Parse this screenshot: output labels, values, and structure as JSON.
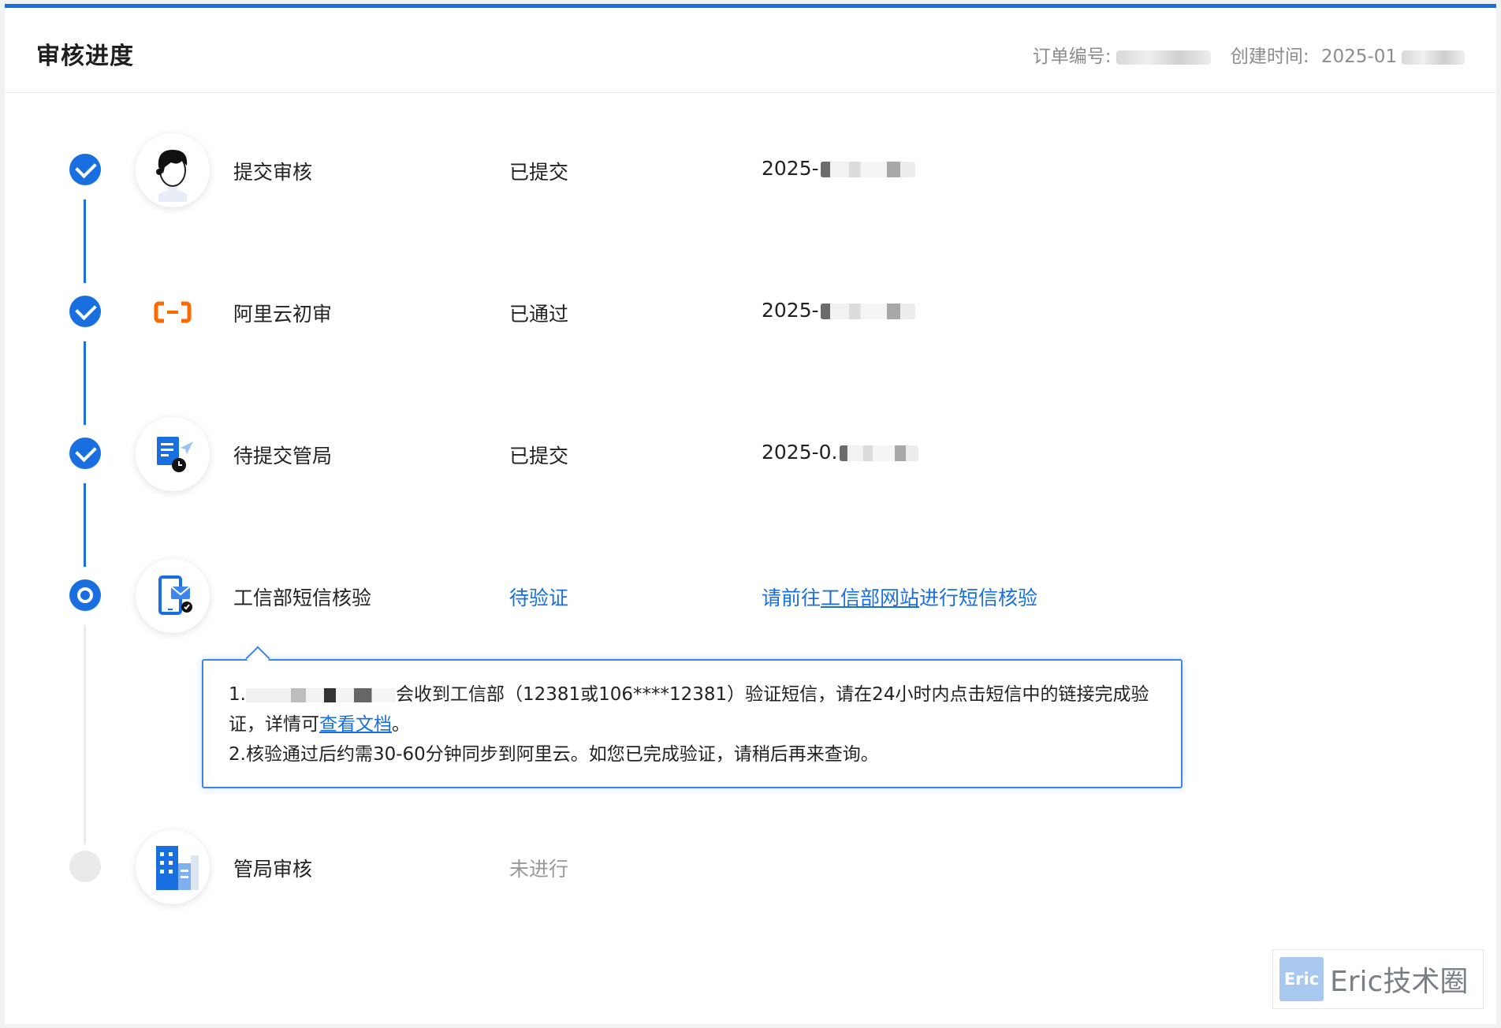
{
  "header": {
    "title": "审核进度",
    "order_label": "订单编号:",
    "created_label": "创建时间:",
    "created_value": "2025-01"
  },
  "steps": [
    {
      "name": "提交审核",
      "status": "已提交",
      "time": "2025-",
      "icon": "user-avatar-icon",
      "state": "done"
    },
    {
      "name": "阿里云初审",
      "status": "已通过",
      "time": "2025-",
      "icon": "aliyun-logo-icon",
      "state": "done"
    },
    {
      "name": "待提交管局",
      "status": "已提交",
      "time": "2025-0.",
      "icon": "document-send-icon",
      "state": "done"
    },
    {
      "name": "工信部短信核验",
      "status": "待验证",
      "action_prefix": "请前往",
      "action_link": "工信部网站",
      "action_suffix": "进行短信核验",
      "icon": "phone-message-icon",
      "state": "current"
    },
    {
      "name": "管局审核",
      "status": "未进行",
      "icon": "building-icon",
      "state": "pending"
    }
  ],
  "tooltip": {
    "line1_prefix": "1.",
    "line1_text": "会收到工信部（12381或106****12381）验证短信，请在24小时内点击短信中的链接完成验",
    "line1b_text": "证，详情可",
    "doc_link": "查看文档",
    "line1b_end": "。",
    "line2_text": "2.核验通过后约需30-60分钟同步到阿里云。如您已完成验证，请稍后再来查询。"
  },
  "watermark": {
    "logo": "Eric",
    "text": "Eric技术圈"
  },
  "colors": {
    "accent": "#1a6fe0",
    "pending": "#e9eaec",
    "aliyun_orange": "#ff6a00"
  }
}
